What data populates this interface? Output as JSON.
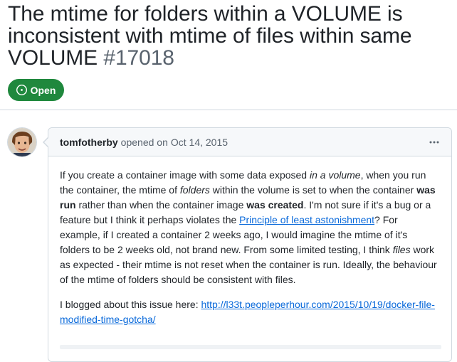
{
  "issue": {
    "title": "The mtime for folders within a VOLUME is inconsistent with mtime of files within same VOLUME",
    "number": "#17018",
    "state": "Open",
    "state_icon": "issue-opened-icon",
    "state_color": "#1f883d"
  },
  "comment": {
    "author": "tomfotherby",
    "action": "opened on",
    "date": "Oct 14, 2015",
    "menu_icon": "kebab-horizontal-icon",
    "p1": {
      "t1": "If you create a container image with some data exposed ",
      "e1": "in a volume",
      "t2": ", when you run the container, the mtime of ",
      "e2": "folders",
      "t3": " within the volume is set to when the container ",
      "s1": "was run",
      "t4": " rather than when the container image ",
      "s2": "was created",
      "t5": ". I'm not sure if it's a bug or a feature but I think it perhaps violates the ",
      "link": "Principle of least astonishment",
      "t6": "? For example, if I created a container 2 weeks ago, I would imagine the mtime of it's folders to be 2 weeks old, not brand new. From some limited testing, I think ",
      "e3": "files",
      "t7": " work as expected - their mtime is not reset when the container is run. Ideally, the behaviour of the mtime of folders should be consistent with files."
    },
    "p2": {
      "t1": "I blogged about this issue here: ",
      "link": "http://l33t.peopleperhour.com/2015/10/19/docker-file-modified-time-gotcha/"
    }
  },
  "colors": {
    "link": "#0969da",
    "muted": "#59636e",
    "border": "#d1d9e0"
  }
}
